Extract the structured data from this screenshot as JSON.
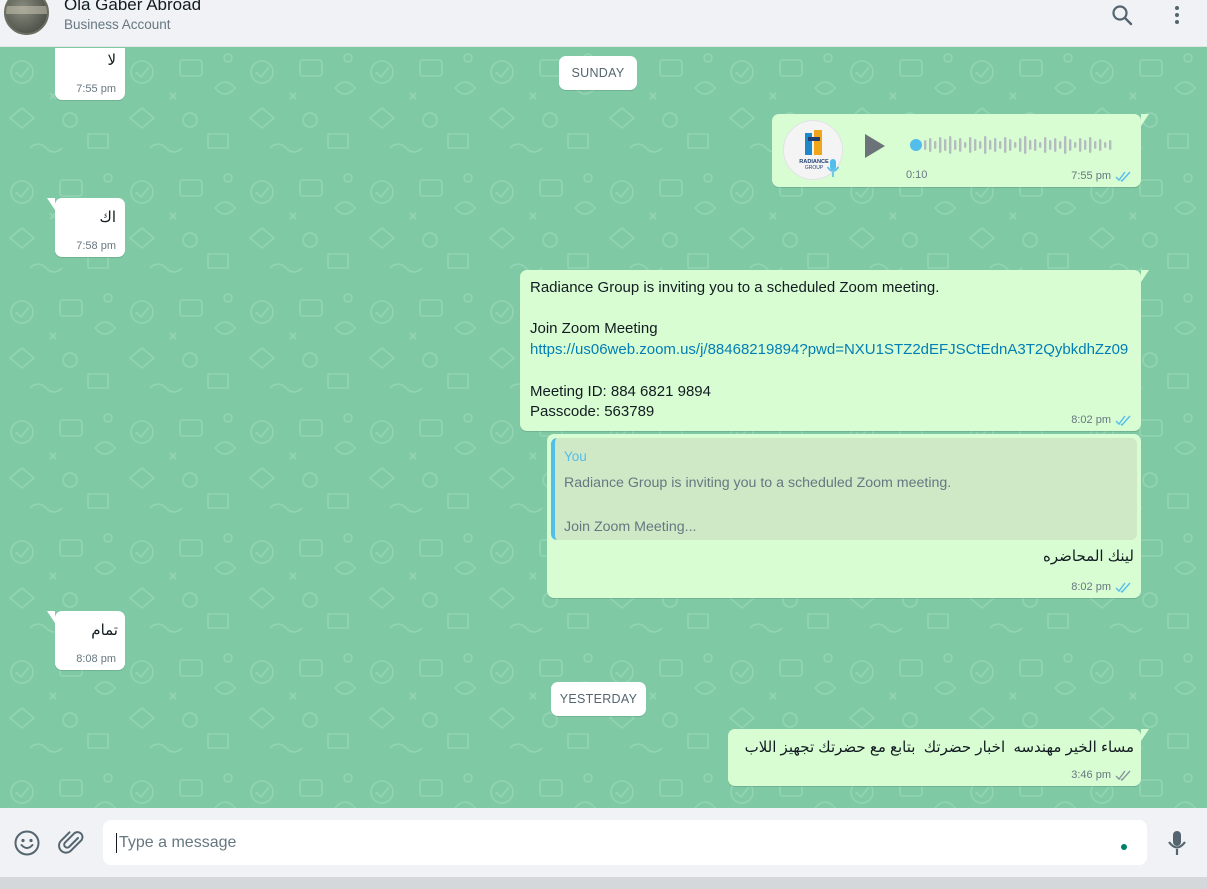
{
  "header": {
    "contact_name": "Ola Gaber Abroad",
    "contact_subtitle": "Business Account"
  },
  "day_labels": {
    "sunday": "SUNDAY",
    "yesterday": "YESTERDAY"
  },
  "messages": [
    {
      "direction": "in",
      "text": "لا",
      "time": "7:55 pm"
    },
    {
      "direction": "out",
      "type": "voice",
      "duration": "0:10",
      "time": "7:55 pm",
      "status": "read",
      "avatar_text": "RADIANCE GROUP"
    },
    {
      "direction": "in",
      "text": "اك",
      "time": "7:58 pm"
    },
    {
      "direction": "out",
      "type": "zoom",
      "line1": "Radiance Group is inviting you to a scheduled Zoom meeting.",
      "line2": "Join Zoom Meeting",
      "link": "https://us06web.zoom.us/j/88468219894?pwd=NXU1STZ2dEFJSCtEdnA3T2QybkdhZz09",
      "meeting_id": "Meeting ID: 884 6821 9894",
      "passcode": "Passcode: 563789",
      "time": "8:02 pm",
      "status": "read"
    },
    {
      "direction": "out",
      "type": "reply",
      "quote_author": "You",
      "quote_line1": "Radiance Group is inviting you to a scheduled Zoom meeting.",
      "quote_line2": "Join Zoom Meeting...",
      "text": "لينك المحاضره",
      "time": "8:02 pm",
      "status": "read"
    },
    {
      "direction": "in",
      "text": "تمام",
      "time": "8:08 pm"
    },
    {
      "direction": "out",
      "text": "مساء الخير مهندسه  اخبار حضرتك  بتابع مع حضرتك تجهيز اللاب",
      "time": "3:46 pm",
      "status": "delivered"
    }
  ],
  "composer": {
    "placeholder": "Type a message"
  },
  "icons": {
    "search": "search-icon",
    "menu": "kebab-menu-icon",
    "emoji": "emoji-icon",
    "attach": "paperclip-icon",
    "mic": "microphone-icon",
    "play": "play-icon"
  },
  "colors": {
    "chat_background": "#7fc9a5",
    "outgoing_bubble": "#d9fdd3",
    "incoming_bubble": "#ffffff",
    "read_ticks": "#53bdeb",
    "link": "#027eb5"
  }
}
